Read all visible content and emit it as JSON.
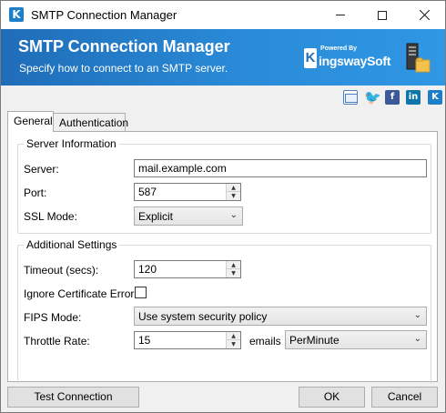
{
  "window": {
    "title": "SMTP Connection Manager"
  },
  "banner": {
    "title": "SMTP Connection Manager",
    "subtitle": "Specify how to connect to an SMTP server.",
    "logo_powered": "Powered By",
    "logo_name": "ingswaySoft",
    "logo_k": "K"
  },
  "social": {
    "icons": [
      "mail-icon",
      "twitter-icon",
      "facebook-icon",
      "linkedin-icon",
      "kingswaysoft-icon"
    ]
  },
  "tabs": {
    "general": "General",
    "authentication": "Authentication"
  },
  "server_info": {
    "legend": "Server Information",
    "server_label": "Server:",
    "server_value": "mail.example.com",
    "port_label": "Port:",
    "port_value": "587",
    "ssl_label": "SSL Mode:",
    "ssl_value": "Explicit"
  },
  "additional": {
    "legend": "Additional Settings",
    "timeout_label": "Timeout (secs):",
    "timeout_value": "120",
    "ignore_cert_label": "Ignore Certificate Errors:",
    "ignore_cert_checked": false,
    "fips_label": "FIPS Mode:",
    "fips_value": "Use system security policy",
    "throttle_label": "Throttle Rate:",
    "throttle_value": "15",
    "throttle_unit": "emails",
    "throttle_period": "PerMinute"
  },
  "buttons": {
    "test": "Test Connection",
    "ok": "OK",
    "cancel": "Cancel"
  }
}
